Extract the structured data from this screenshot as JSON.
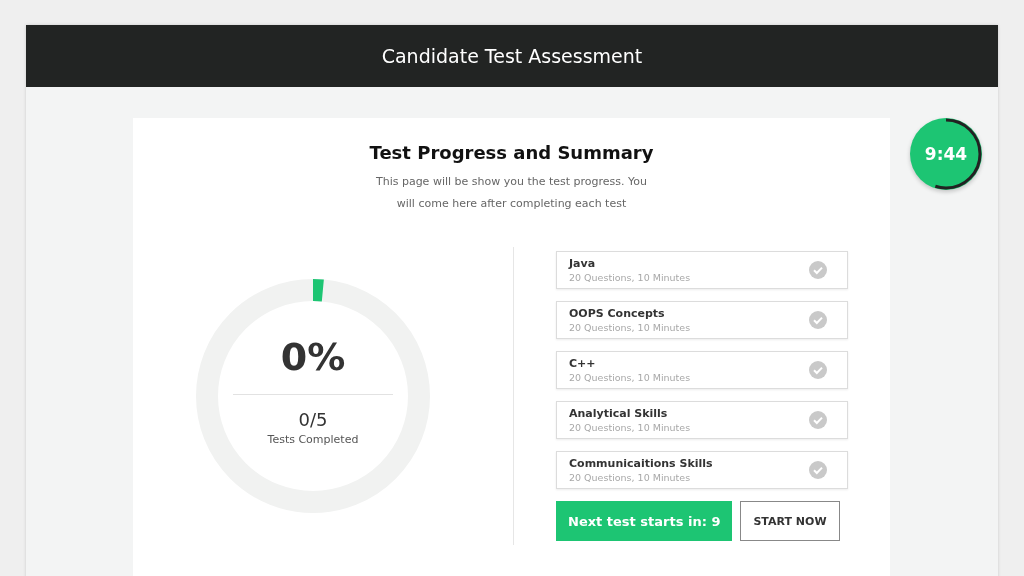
{
  "window": {
    "title": "Candidate Test Assessment"
  },
  "timer": {
    "time": "9:44"
  },
  "summary": {
    "title": "Test Progress and Summary",
    "description": "This page will be show you the test progress. You will come here after completing each test"
  },
  "progress": {
    "percent": "0%",
    "count": "0/5",
    "caption": "Tests Completed"
  },
  "tests": [
    {
      "name": "Java",
      "details": "20 Questions, 10 Minutes",
      "completed": false
    },
    {
      "name": "OOPS Concepts",
      "details": "20 Questions, 10 Minutes",
      "completed": false
    },
    {
      "name": "C++",
      "details": "20 Questions, 10 Minutes",
      "completed": false
    },
    {
      "name": "Analytical Skills",
      "details": "20 Questions, 10 Minutes",
      "completed": false
    },
    {
      "name": "Communicaitions Skills",
      "details": "20 Questions, 10 Minutes",
      "completed": false
    }
  ],
  "buttons": [
    {
      "label": "Next test starts in: 9",
      "kind": "primary"
    },
    {
      "label": "START NOW",
      "kind": "outline"
    }
  ]
}
